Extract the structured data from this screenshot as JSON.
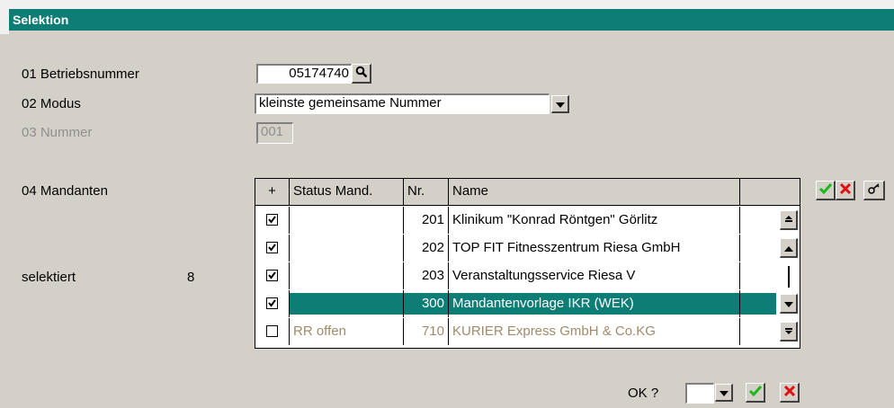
{
  "window": {
    "title": "Selektion"
  },
  "fields": {
    "betriebsnummer": {
      "label": "01 Betriebsnummer",
      "value": "05174740"
    },
    "modus": {
      "label": "02 Modus",
      "value": "kleinste gemeinsame Nummer"
    },
    "nummer": {
      "label": "03 Nummer",
      "value": "001"
    },
    "mandanten": {
      "label": "04 Mandanten"
    }
  },
  "selection": {
    "label": "selektiert",
    "count": "8"
  },
  "grid": {
    "columns": [
      "+",
      "Status Mand.",
      "Nr.",
      "Name"
    ],
    "rows": [
      {
        "checked": true,
        "status": "",
        "nr": "201",
        "name": "Klinikum \"Konrad Röntgen\" Görlitz"
      },
      {
        "checked": true,
        "status": "",
        "nr": "202",
        "name": "TOP FIT Fitnesszentrum Riesa GmbH"
      },
      {
        "checked": true,
        "status": "",
        "nr": "203",
        "name": "Veranstaltungsservice Riesa V"
      },
      {
        "checked": true,
        "status": "",
        "nr": "300",
        "name": "Mandantenvorlage IKR (WEK)",
        "selected": true
      },
      {
        "checked": false,
        "status": "RR offen",
        "nr": "710",
        "name": "KURIER Express GmbH & Co.KG",
        "inactive": true
      }
    ]
  },
  "footer": {
    "ok_label": "OK ?",
    "ok_value": ""
  },
  "colors": {
    "accent": "#0e7d76",
    "panel": "#d4d0c8",
    "inactive_text": "#a08a6a"
  },
  "icons": [
    "search-icon",
    "dropdown-arrow-icon",
    "check-icon",
    "cross-icon",
    "key-icon",
    "scroll-top-icon",
    "scroll-up-icon",
    "scroll-down-icon",
    "scroll-bottom-icon"
  ]
}
